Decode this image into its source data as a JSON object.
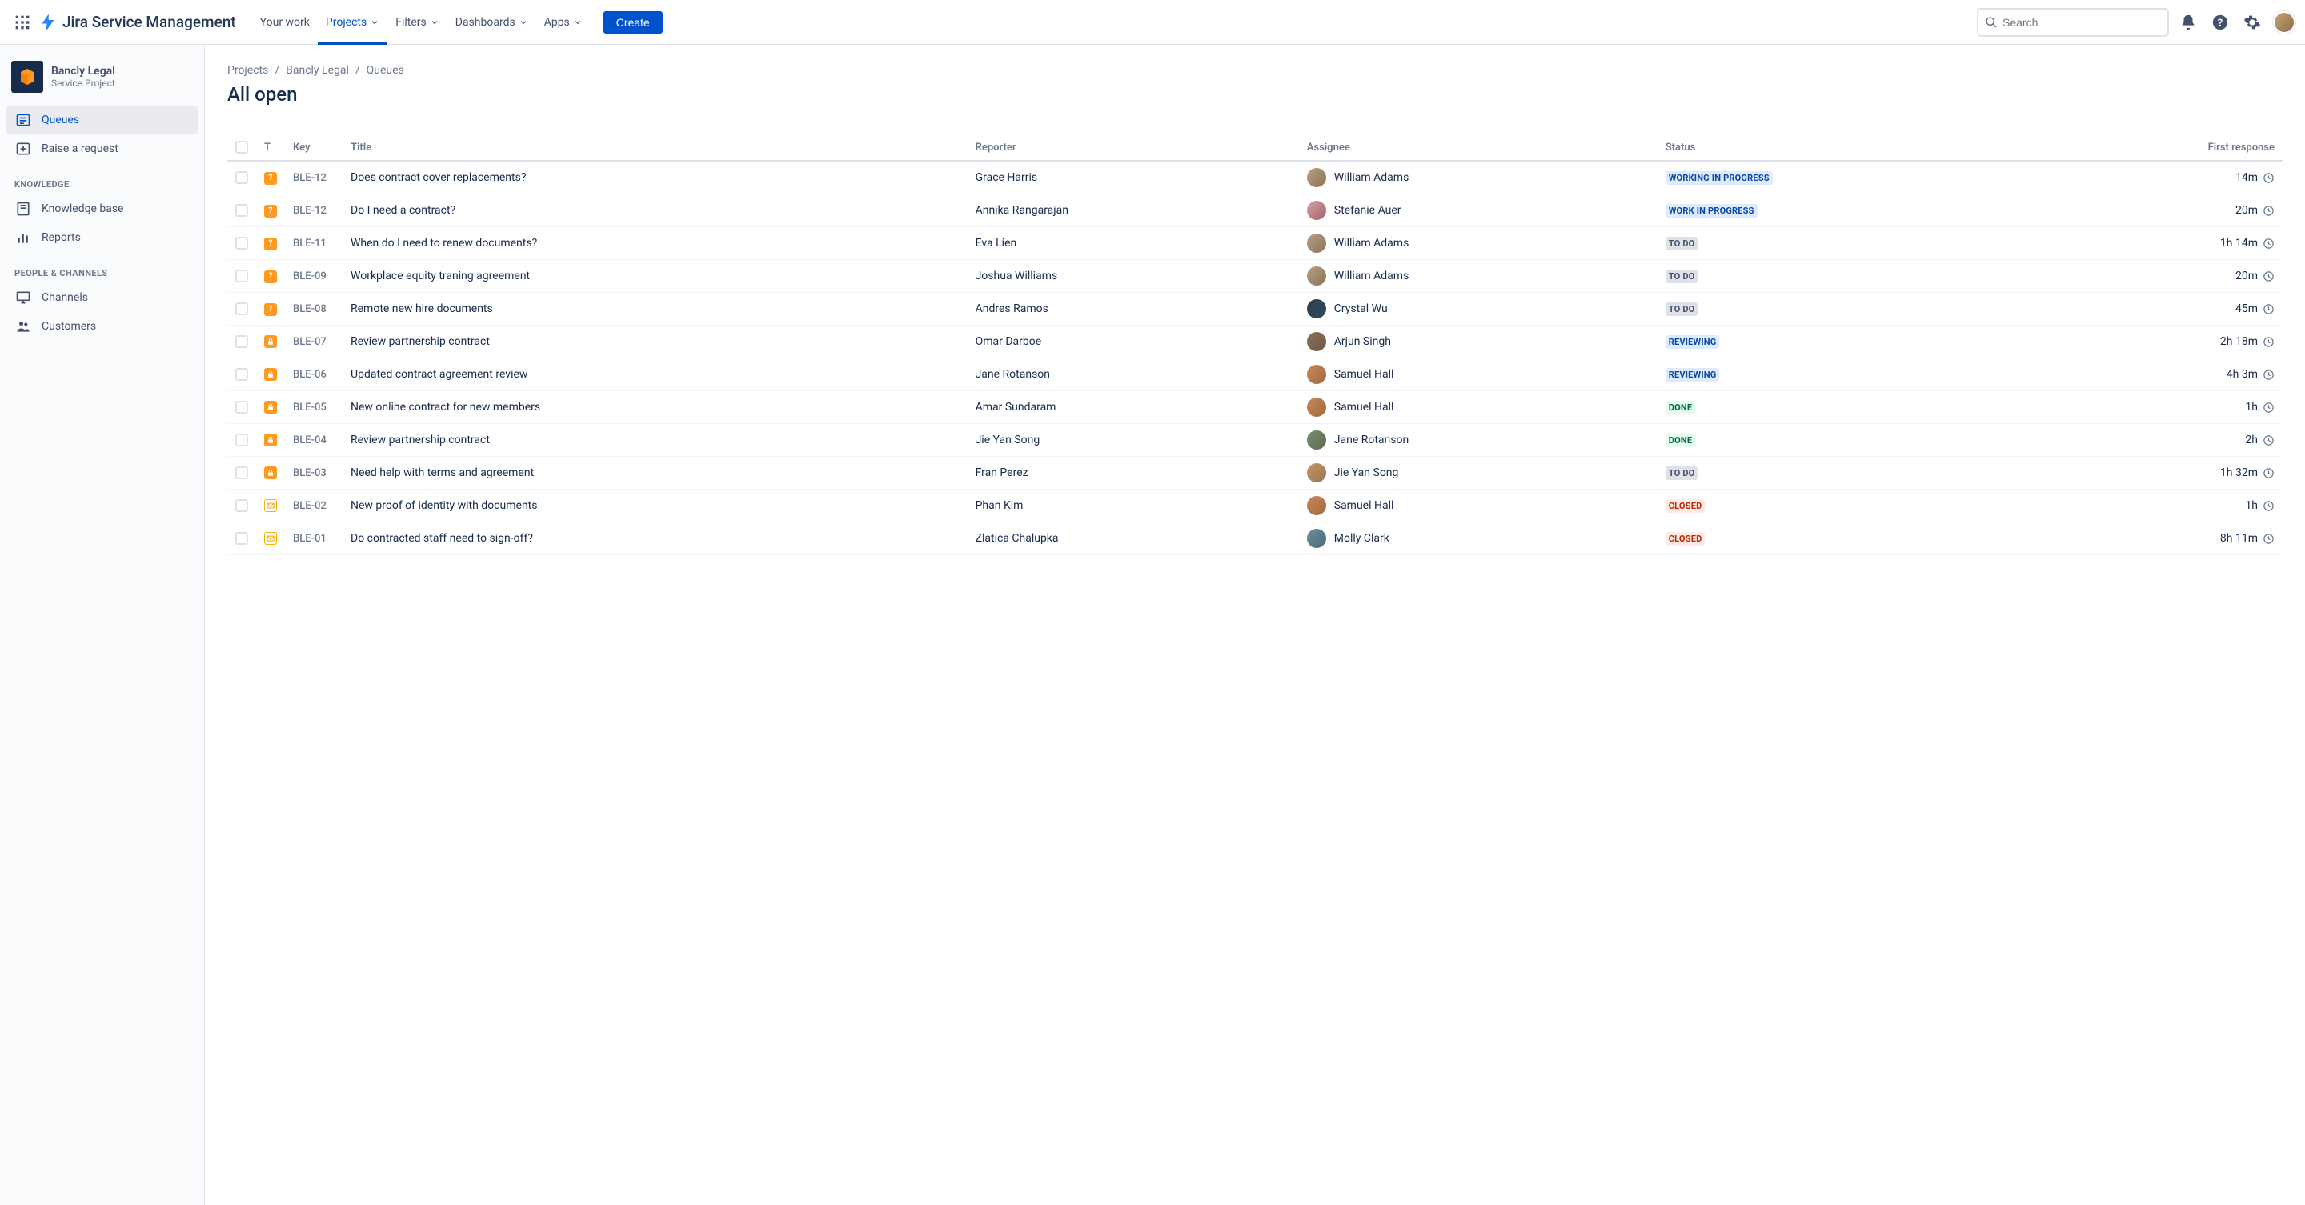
{
  "topnav": {
    "product": "Jira Service Management",
    "items": [
      {
        "label": "Your work",
        "hasChevron": false
      },
      {
        "label": "Projects",
        "hasChevron": true,
        "active": true
      },
      {
        "label": "Filters",
        "hasChevron": true
      },
      {
        "label": "Dashboards",
        "hasChevron": true
      },
      {
        "label": "Apps",
        "hasChevron": true
      }
    ],
    "create": "Create",
    "searchPlaceholder": "Search"
  },
  "sidebar": {
    "project": {
      "name": "Bancly Legal",
      "type": "Service Project"
    },
    "topItems": [
      {
        "label": "Queues",
        "icon": "queue",
        "selected": true
      },
      {
        "label": "Raise a request",
        "icon": "raise"
      }
    ],
    "sections": [
      {
        "heading": "KNOWLEDGE",
        "items": [
          {
            "label": "Knowledge base",
            "icon": "book"
          },
          {
            "label": "Reports",
            "icon": "chart"
          }
        ]
      },
      {
        "heading": "PEOPLE & CHANNELS",
        "items": [
          {
            "label": "Channels",
            "icon": "monitor"
          },
          {
            "label": "Customers",
            "icon": "people"
          }
        ]
      }
    ]
  },
  "breadcrumb": [
    "Projects",
    "Bancly Legal",
    "Queues"
  ],
  "pageTitle": "All open",
  "table": {
    "columns": [
      "",
      "T",
      "Key",
      "Title",
      "Reporter",
      "Assignee",
      "Status",
      "First response"
    ],
    "rows": [
      {
        "type": "question",
        "key": "BLE-12",
        "title": "Does contract cover replacements?",
        "reporter": "Grace Harris",
        "assignee": "William Adams",
        "avcls": "av-c1",
        "status": "WORKING IN PROGRESS",
        "statusCls": "loz-wip",
        "fr": "14m"
      },
      {
        "type": "question",
        "key": "BLE-12",
        "title": "Do I need a contract?",
        "reporter": "Annika Rangarajan",
        "assignee": "Stefanie Auer",
        "avcls": "av-c2",
        "status": "WORK IN PROGRESS",
        "statusCls": "loz-wip",
        "fr": "20m"
      },
      {
        "type": "question",
        "key": "BLE-11",
        "title": "When do I need to renew documents?",
        "reporter": "Eva Lien",
        "assignee": "William Adams",
        "avcls": "av-c1",
        "status": "TO DO",
        "statusCls": "loz-todo",
        "fr": "1h 14m"
      },
      {
        "type": "question",
        "key": "BLE-09",
        "title": "Workplace equity traning agreement",
        "reporter": "Joshua Williams",
        "assignee": "William Adams",
        "avcls": "av-c1",
        "status": "TO DO",
        "statusCls": "loz-todo",
        "fr": "20m"
      },
      {
        "type": "question",
        "key": "BLE-08",
        "title": "Remote new hire documents",
        "reporter": "Andres Ramos",
        "assignee": "Crystal Wu",
        "avcls": "av-c3",
        "status": "TO DO",
        "statusCls": "loz-todo",
        "fr": "45m"
      },
      {
        "type": "lock",
        "key": "BLE-07",
        "title": "Review partnership contract",
        "reporter": "Omar Darboe",
        "assignee": "Arjun Singh",
        "avcls": "av-c4",
        "status": "REVIEWING",
        "statusCls": "loz-reviewing",
        "fr": "2h 18m"
      },
      {
        "type": "lock",
        "key": "BLE-06",
        "title": "Updated contract agreement review",
        "reporter": "Jane Rotanson",
        "assignee": "Samuel Hall",
        "avcls": "av-c5",
        "status": "REVIEWING",
        "statusCls": "loz-reviewing",
        "fr": "4h 3m"
      },
      {
        "type": "lock",
        "key": "BLE-05",
        "title": "New online contract for new members",
        "reporter": "Amar Sundaram",
        "assignee": "Samuel Hall",
        "avcls": "av-c5",
        "status": "DONE",
        "statusCls": "loz-done",
        "fr": "1h"
      },
      {
        "type": "lock",
        "key": "BLE-04",
        "title": "Review partnership contract",
        "reporter": "Jie Yan Song",
        "assignee": "Jane Rotanson",
        "avcls": "av-c6",
        "status": "DONE",
        "statusCls": "loz-done",
        "fr": "2h"
      },
      {
        "type": "lock",
        "key": "BLE-03",
        "title": "Need help with terms and agreement",
        "reporter": "Fran Perez",
        "assignee": "Jie Yan Song",
        "avcls": "av-c7",
        "status": "TO DO",
        "statusCls": "loz-todo",
        "fr": "1h 32m"
      },
      {
        "type": "mail",
        "key": "BLE-02",
        "title": "New proof of identity with documents",
        "reporter": "Phan Kim",
        "assignee": "Samuel Hall",
        "avcls": "av-c5",
        "status": "CLOSED",
        "statusCls": "loz-closed",
        "fr": "1h"
      },
      {
        "type": "mail",
        "key": "BLE-01",
        "title": "Do contracted staff need to sign-off?",
        "reporter": "Zlatica Chalupka",
        "assignee": "Molly Clark",
        "avcls": "av-c8",
        "status": "CLOSED",
        "statusCls": "loz-closed",
        "fr": "8h 11m"
      }
    ]
  }
}
